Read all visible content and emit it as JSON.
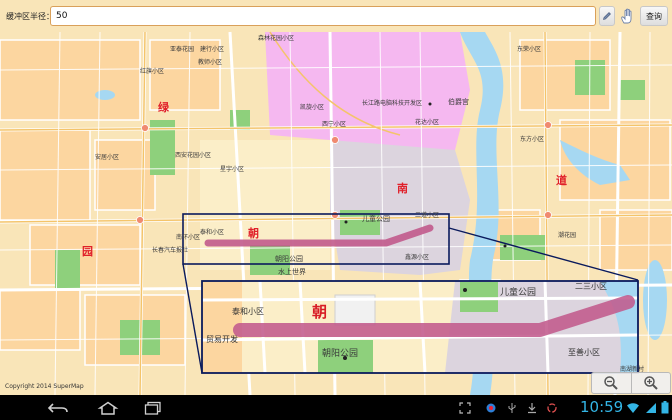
{
  "search_bar": {
    "radius_label": "缓冲区半径：",
    "radius_value": "50",
    "query_button": "查询",
    "pencil_icon": "pencil-icon",
    "hand_icon": "hand-icon"
  },
  "map": {
    "district_labels": [
      "绿",
      "园",
      "朝",
      "南",
      "道"
    ],
    "park_labels": [
      "儿童公园",
      "朝阳公园",
      "水上世界"
    ],
    "area_labels": [
      "森林花园小区",
      "亚泰花园",
      "建行小区",
      "教师小区",
      "红旗小区",
      "安居小区",
      "西安花园小区",
      "星宇小区",
      "长春汽车报社",
      "南环小区",
      "泰和小区",
      "伯爵宫",
      "长江路电脑科技开发区",
      "花达小区",
      "二道小区",
      "鑫源小区",
      "东荣小区",
      "潮花园",
      "东方小区",
      "西宁小区",
      "凯旋小区",
      "南湖新村"
    ],
    "inset_labels": [
      "泰和小区",
      "朝",
      "儿童公园",
      "朝阳公园",
      "二三小区",
      "至善小区",
      "贸易开发"
    ],
    "copyright": "Copyright 2014 SuperMap"
  },
  "zoom": {
    "zoom_out_icon": "zoom-out-icon",
    "zoom_in_icon": "zoom-in-icon"
  },
  "status_bar": {
    "time": "10:59"
  },
  "colors": {
    "residential": "#f9e5b8",
    "commercial": "#fcd6a0",
    "green": "#8ed07c",
    "water": "#a6d8f2",
    "pink_zone": "#f5b8f0",
    "gray_zone": "#dcd4de",
    "buffer": "#c15a8c",
    "selection": "#0a1a5c"
  }
}
